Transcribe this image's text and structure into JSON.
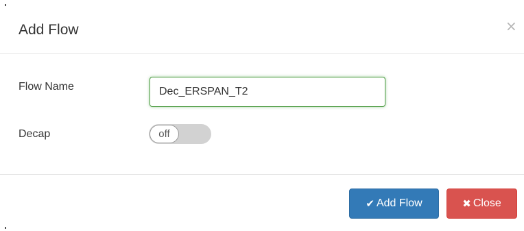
{
  "dialog": {
    "title": "Add Flow",
    "close_glyph": "×"
  },
  "form": {
    "flow_name": {
      "label": "Flow Name",
      "value": "Dec_ERSPAN_T2"
    },
    "decap": {
      "label": "Decap",
      "state_text": "off"
    }
  },
  "footer": {
    "add_button": {
      "icon": "check-icon",
      "glyph": "✔",
      "label": "Add Flow",
      "color": "#337ab7"
    },
    "close_button": {
      "icon": "close-icon",
      "glyph": "✖",
      "label": "Close",
      "color": "#d9534f"
    }
  }
}
